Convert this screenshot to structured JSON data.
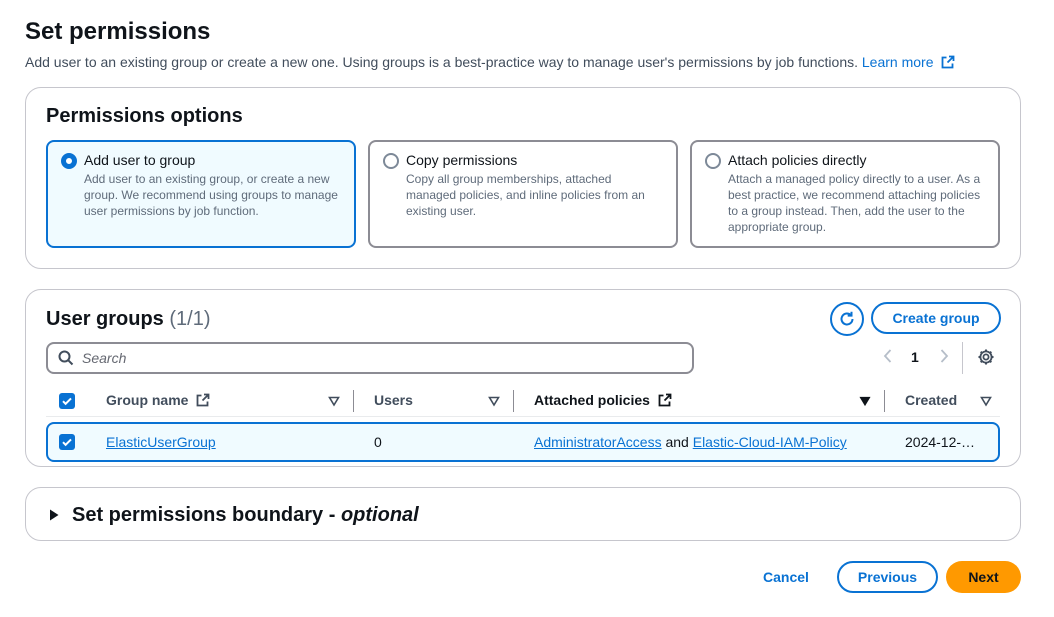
{
  "header": {
    "title": "Set permissions",
    "description": "Add user to an existing group or create a new one. Using groups is a best-practice way to manage user's permissions by job functions.",
    "learn_more": "Learn more"
  },
  "permissions_options": {
    "heading": "Permissions options",
    "tiles": [
      {
        "title": "Add user to group",
        "description": "Add user to an existing group, or create a new group. We recommend using groups to manage user permissions by job function.",
        "selected": true
      },
      {
        "title": "Copy permissions",
        "description": "Copy all group memberships, attached managed policies, and inline policies from an existing user.",
        "selected": false
      },
      {
        "title": "Attach policies directly",
        "description": "Attach a managed policy directly to a user. As a best practice, we recommend attaching policies to a group instead. Then, add the user to the appropriate group.",
        "selected": false
      }
    ]
  },
  "user_groups": {
    "heading": "User groups",
    "count": "(1/1)",
    "create_group_label": "Create group",
    "search_placeholder": "Search",
    "page_number": "1",
    "columns": [
      "Group name",
      "Users",
      "Attached policies",
      "Created"
    ],
    "rows": [
      {
        "group_name": "ElasticUserGroup",
        "users": "0",
        "policy_1": "AdministratorAccess",
        "policy_joiner": "and",
        "policy_2": "Elastic-Cloud-IAM-Policy",
        "created": "2024-12-…",
        "checked": true
      }
    ]
  },
  "boundary": {
    "title": "Set permissions boundary - ",
    "optional": "optional"
  },
  "footer": {
    "cancel_label": "Cancel",
    "previous_label": "Previous",
    "next_label": "Next"
  },
  "colors": {
    "accent": "#0972d3",
    "primary_button": "#ff9900",
    "selected_bg": "#f0fbff"
  }
}
